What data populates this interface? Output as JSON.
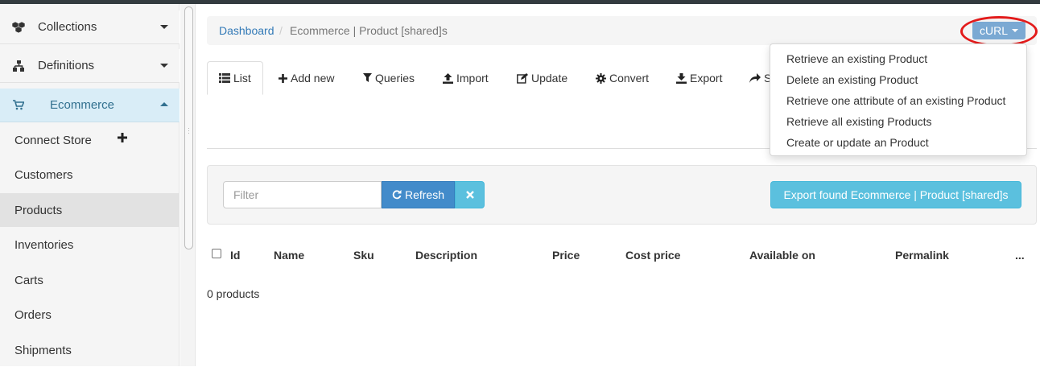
{
  "sidebar": {
    "sections": [
      {
        "label": "Collections",
        "icon": "cubes-icon"
      },
      {
        "label": "Definitions",
        "icon": "sitemap-icon"
      },
      {
        "label": "Ecommerce",
        "icon": "cart-icon"
      }
    ],
    "items": [
      {
        "label": "Connect Store"
      },
      {
        "label": "Customers"
      },
      {
        "label": "Products"
      },
      {
        "label": "Inventories"
      },
      {
        "label": "Carts"
      },
      {
        "label": "Orders"
      },
      {
        "label": "Shipments"
      }
    ]
  },
  "breadcrumb": {
    "home": "Dashboard",
    "separator": "/",
    "current": "Ecommerce | Product [shared]s"
  },
  "curl": {
    "label": "cURL",
    "menu": [
      "Retrieve an existing Product",
      "Delete an existing Product",
      "Retrieve one attribute of an existing Product",
      "Retrieve all existing Products",
      "Create or update an Product"
    ]
  },
  "tabs": [
    {
      "label": "List",
      "icon": "list-icon"
    },
    {
      "label": "Add new",
      "icon": "plus-icon"
    },
    {
      "label": "Queries",
      "icon": "filter-icon"
    },
    {
      "label": "Import",
      "icon": "upload-icon"
    },
    {
      "label": "Update",
      "icon": "edit-icon"
    },
    {
      "label": "Convert",
      "icon": "gear-icon"
    },
    {
      "label": "Export",
      "icon": "download-icon"
    },
    {
      "label": "S",
      "icon": "share-icon"
    }
  ],
  "filter": {
    "placeholder": "Filter",
    "value": "",
    "refresh_label": "Refresh",
    "export_label": "Export found Ecommerce | Product [shared]s"
  },
  "table": {
    "columns": [
      "Id",
      "Name",
      "Sku",
      "Description",
      "Price",
      "Cost price",
      "Available on",
      "Permalink",
      "..."
    ],
    "count_text": "0 products"
  },
  "colors": {
    "primary": "#428bca",
    "info": "#5bc0de",
    "curl": "#7ba9d3",
    "highlight_circle": "#e31b1b",
    "link": "#337ab7"
  }
}
